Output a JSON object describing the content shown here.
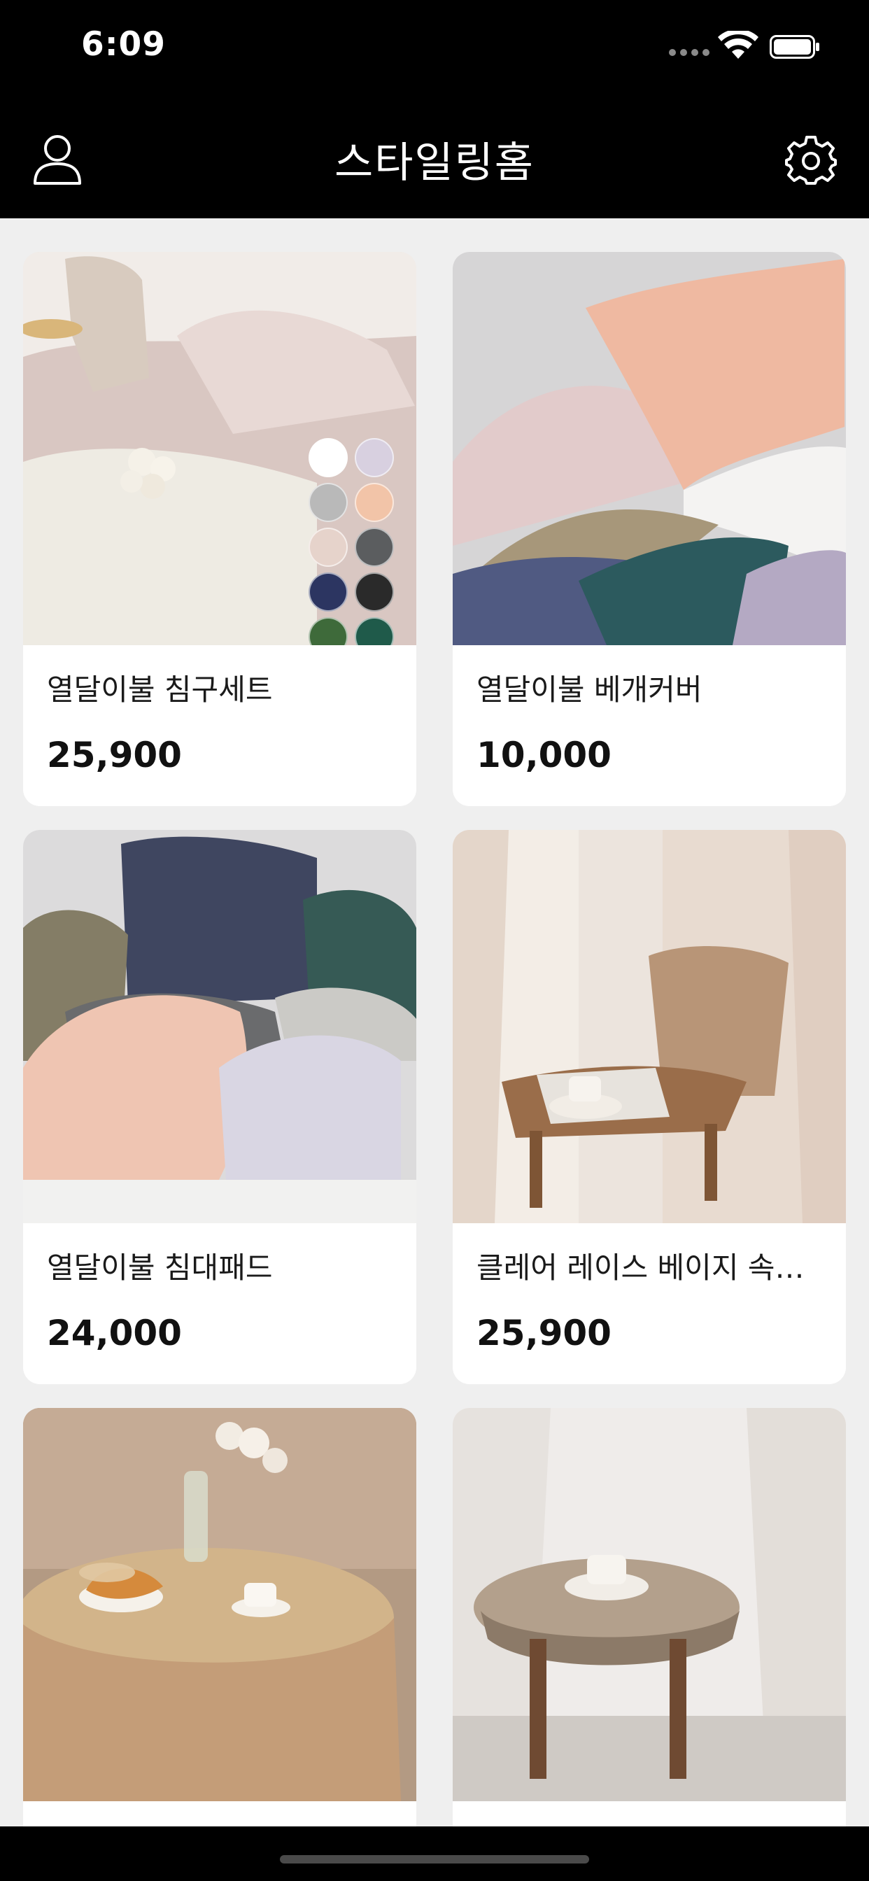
{
  "status": {
    "time": "6:09"
  },
  "nav": {
    "title": "스타일링홈",
    "profile_icon": "person-icon",
    "settings_icon": "gear-icon"
  },
  "products": [
    {
      "name": "열달이불 침구세트",
      "price": "25,900",
      "image": "bedding-set-photo"
    },
    {
      "name": "열달이불 베개커버",
      "price": "10,000",
      "image": "pillow-cover-photo"
    },
    {
      "name": "열달이불 침대패드",
      "price": "24,000",
      "image": "bed-pad-photo"
    },
    {
      "name": "클레어 레이스 베이지 속…",
      "price": "25,900",
      "image": "lace-curtain-chair-photo"
    },
    {
      "name": "",
      "price": "",
      "image": "lace-tablecloth-breakfast-photo"
    },
    {
      "name": "",
      "price": "",
      "image": "lace-curtain-stool-photo"
    }
  ],
  "swatch_colors": [
    "#ffffff",
    "#d8d0e0",
    "#b9b9b9",
    "#f2c4a8",
    "#e6d3cb",
    "#5b5d5f",
    "#2c3561",
    "#2a2a2a",
    "#3e6a3a",
    "#1f5a4a"
  ]
}
